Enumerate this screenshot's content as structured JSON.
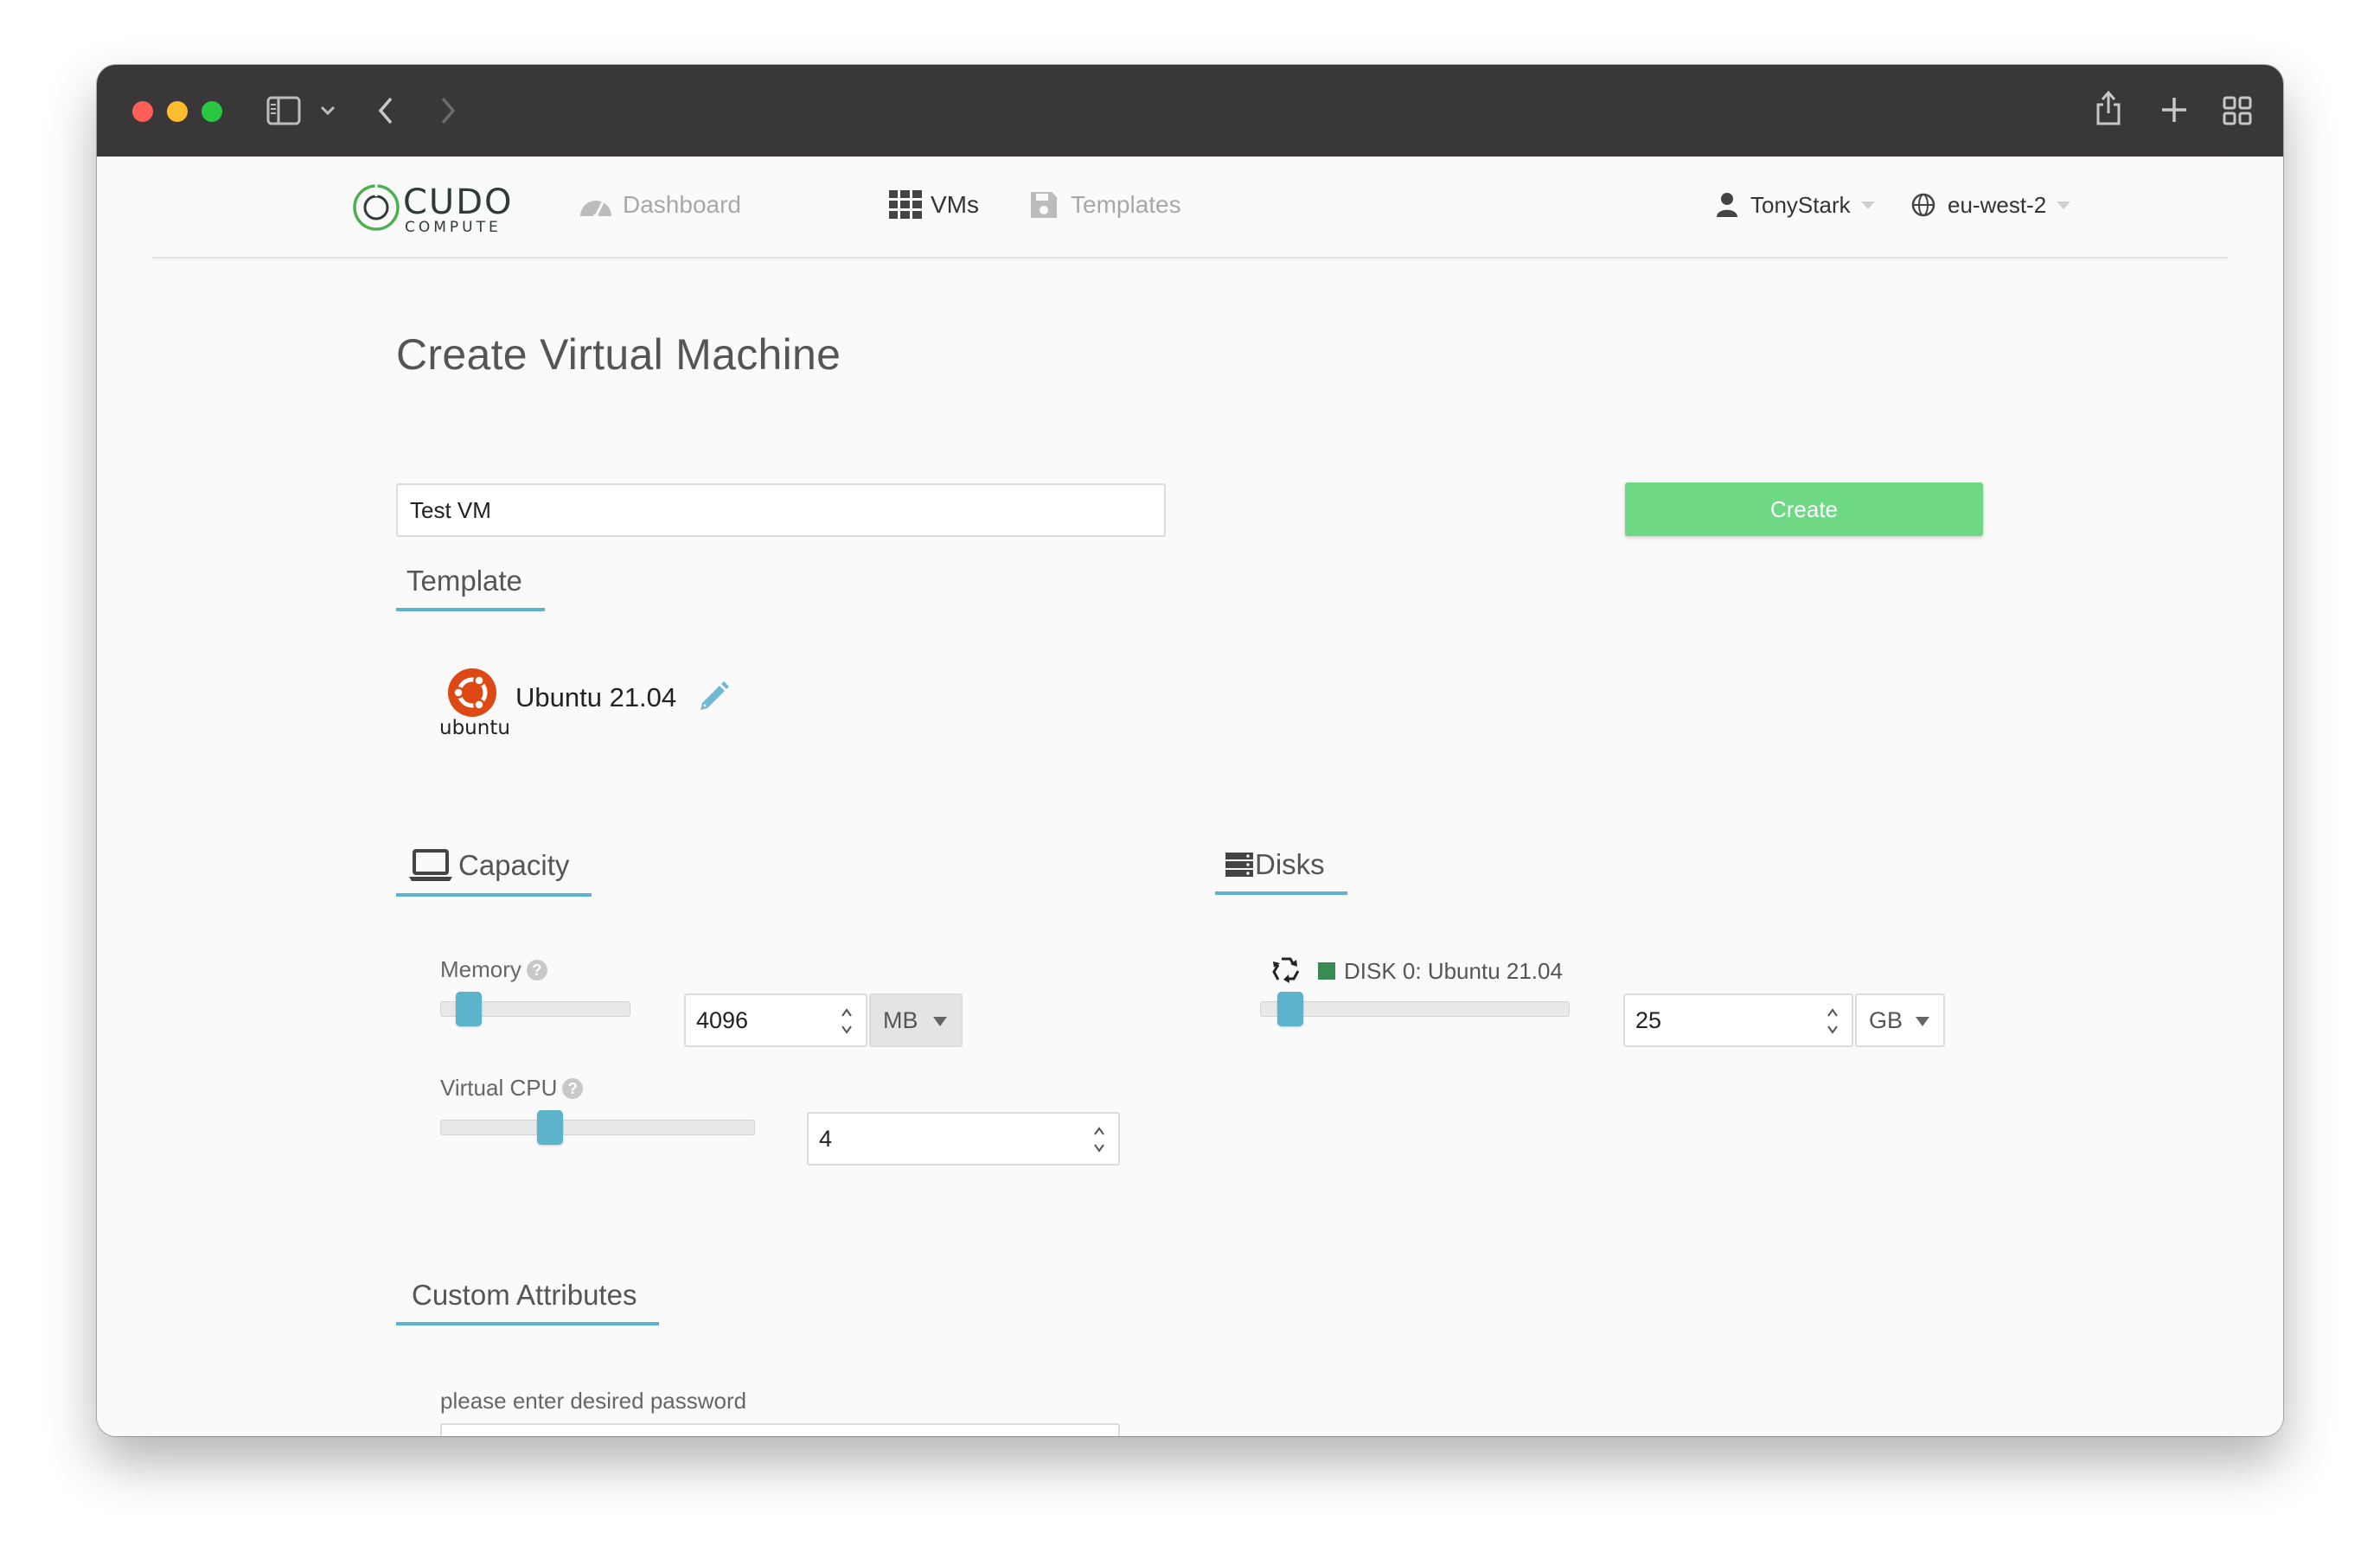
{
  "browser": {
    "colors": {
      "close": "#ff5f57",
      "minimize": "#febc2e",
      "zoom": "#28c840",
      "chrome": "#3a3739"
    }
  },
  "brand": {
    "name": "CUDO",
    "sub": "COMPUTE",
    "accent": "#4caf50"
  },
  "nav": {
    "dashboard": "Dashboard",
    "vms": "VMs",
    "templates": "Templates",
    "user": "TonyStark",
    "region": "eu-west-2"
  },
  "page": {
    "title": "Create Virtual Machine",
    "name_value": "Test VM",
    "create_label": "Create",
    "create_color": "#6fd885"
  },
  "template": {
    "tab": "Template",
    "logo_text": "ubuntu",
    "name": "Ubuntu 21.04",
    "logo_color": "#dd4814"
  },
  "capacity": {
    "tab": "Capacity",
    "memory_label": "Memory",
    "memory_value": "4096",
    "memory_unit": "MB",
    "memory_slider_level": 0.06,
    "vcpu_label": "Virtual CPU",
    "vcpu_value": "4",
    "vcpu_slider_level": 0.33
  },
  "disks": {
    "tab": "Disks",
    "disk_label": "DISK 0: Ubuntu 21.04",
    "disk_color": "#3a8a55",
    "disk_value": "25",
    "disk_unit": "GB",
    "disk_slider_level": 0.04
  },
  "custom": {
    "tab": "Custom Attributes",
    "password_label": "please enter desired password"
  },
  "accent": "#5bb4cc"
}
